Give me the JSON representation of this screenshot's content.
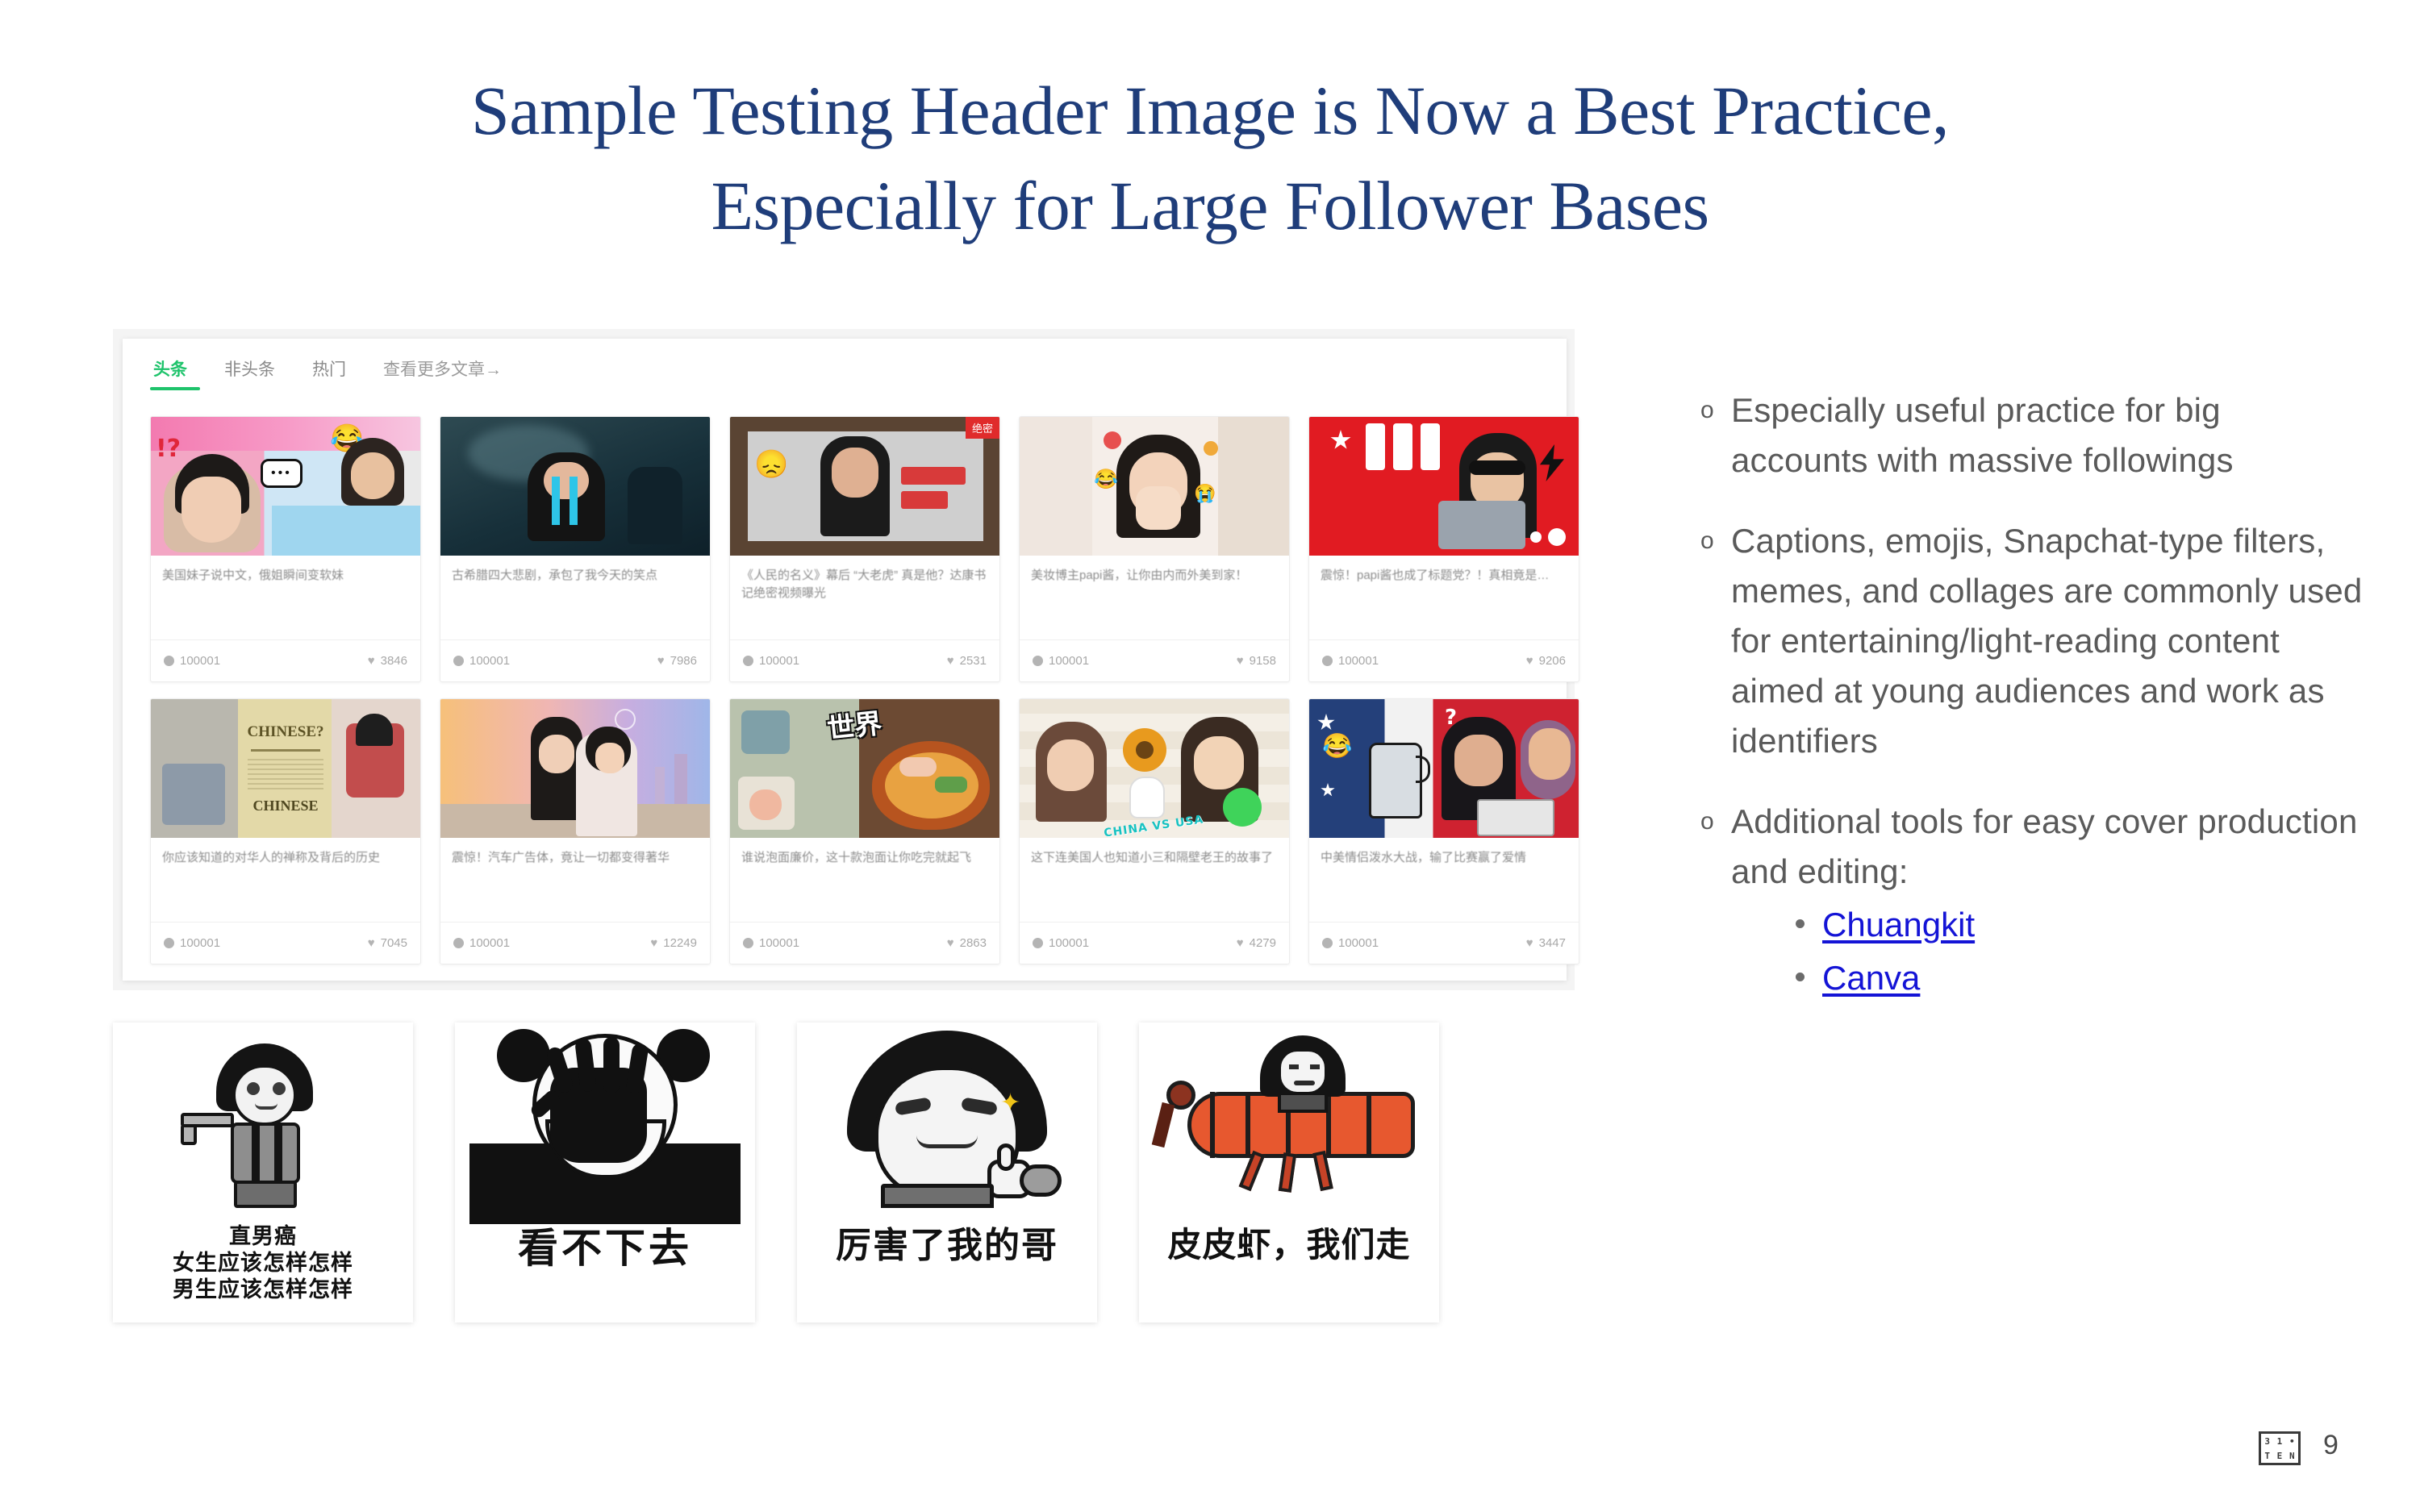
{
  "slide": {
    "title_line1": "Sample Testing Header Image is Now a Best Practice,",
    "title_line2": "Especially for Large Follower Bases",
    "title_color": "#1F3D7A",
    "page_number": "9",
    "logo_chars": [
      "3",
      "1",
      "•",
      "T",
      "E",
      "N"
    ]
  },
  "screenshot": {
    "tabs": [
      {
        "label": "头条",
        "active": true
      },
      {
        "label": "非头条",
        "active": false
      },
      {
        "label": "热门",
        "active": false
      },
      {
        "label": "查看更多文章→",
        "active": false
      }
    ],
    "active_tab_color": "#1ec36b",
    "articles": [
      {
        "title": "美国妹子说中文，俄姐瞬间变软妹",
        "views": "100001",
        "likes": "3846"
      },
      {
        "title": "古希腊四大悲剧，承包了我今天的笑点",
        "views": "100001",
        "likes": "7986"
      },
      {
        "title": "《人民的名义》幕后 “大老虎” 真是他？达康书记绝密视频曝光",
        "views": "100001",
        "likes": "2531"
      },
      {
        "title": "美妆博主papi酱，让你由内而外美到家！",
        "views": "100001",
        "likes": "9158"
      },
      {
        "title": "震惊！papi酱也成了标题党？！真相竟是…",
        "views": "100001",
        "likes": "9206"
      },
      {
        "title": "你应该知道的对华人的禅称及背后的历史",
        "views": "100001",
        "likes": "7045"
      },
      {
        "title": "震惊！汽车广告体，竟让一切都变得著华",
        "views": "100001",
        "likes": "12249"
      },
      {
        "title": "谁说泡面廉价，这十款泡面让你吃完就起飞",
        "views": "100001",
        "likes": "2863"
      },
      {
        "title": "这下连美国人也知道小三和隔壁老王的故事了",
        "views": "100001",
        "likes": "4279"
      },
      {
        "title": "中美情侣泼水大战，输了比赛赢了爱情",
        "views": "100001",
        "likes": "3447"
      }
    ],
    "thumb_overlay_texts": {
      "card3_badge": "绝密",
      "card6_poster": "CHINESE?",
      "card6_poster2": "CHINESE",
      "card9_caption": "CHINA VS USA"
    }
  },
  "memes": [
    {
      "caption_lines": [
        "直男癌",
        "女生应该怎样怎样",
        "男生应该怎样怎样"
      ],
      "font_size": 27
    },
    {
      "caption_lines": [
        "看不下去"
      ],
      "font_size": 50
    },
    {
      "caption_lines": [
        "厉害了我的哥"
      ],
      "font_size": 44
    },
    {
      "caption_lines": [
        "皮皮虾，我们走"
      ],
      "font_size": 42
    }
  ],
  "bullets": [
    {
      "marker": "o",
      "text": "Especially useful practice for big accounts with massive followings"
    },
    {
      "marker": "o",
      "text": "Captions, emojis, Snapchat-type filters, memes, and collages are commonly used for entertaining/light-reading content aimed at young audiences and work as identifiers"
    },
    {
      "marker": "o",
      "text": "Additional tools for easy cover production and editing:"
    }
  ],
  "links": [
    {
      "label": "Chuangkit",
      "color": "#1414d6"
    },
    {
      "label": "Canva",
      "color": "#1414d6"
    }
  ]
}
